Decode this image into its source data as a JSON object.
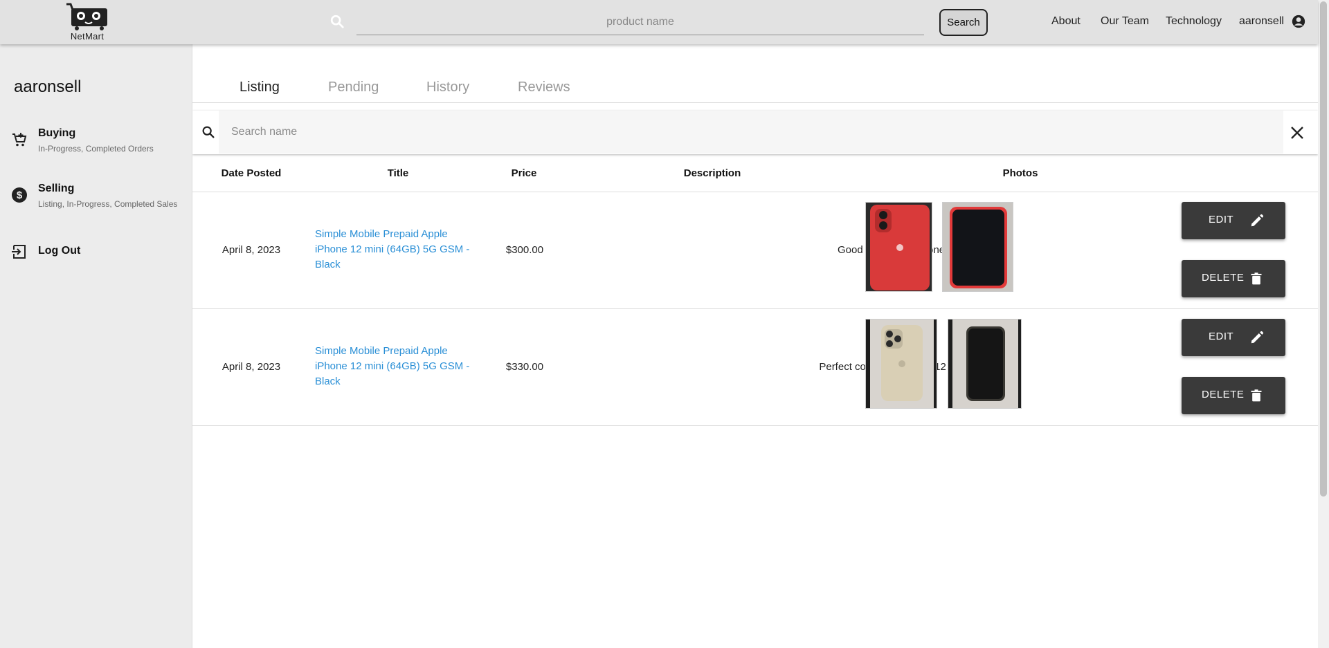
{
  "header": {
    "logo_text": "NetMart",
    "search_placeholder": "product name",
    "search_button": "Search",
    "nav": [
      "About",
      "Our Team",
      "Technology",
      "aaronsell"
    ]
  },
  "sidebar": {
    "username": "aaronsell",
    "items": [
      {
        "label": "Buying",
        "sub": "In-Progress, Completed Orders",
        "icon": "cart-icon"
      },
      {
        "label": "Selling",
        "sub": "Listing, In-Progress, Completed Sales",
        "icon": "dollar-icon"
      },
      {
        "label": "Log Out",
        "sub": "",
        "icon": "logout-icon"
      }
    ]
  },
  "tabs": [
    "Listing",
    "Pending",
    "History",
    "Reviews"
  ],
  "active_tab": "Listing",
  "listing_search": {
    "placeholder": "Search name"
  },
  "table": {
    "headers": [
      "Date Posted",
      "Title",
      "Price",
      "Description",
      "Photos"
    ],
    "rows": [
      {
        "date": "April 8, 2023",
        "title": "Simple Mobile Prepaid Apple iPhone 12 mini (64GB) 5G GSM - Black",
        "price": "$300.00",
        "description": "Good Condition iPhone 12",
        "photos": [
          "red-iphone-back",
          "red-iphone-front"
        ],
        "edit_label": "EDIT",
        "delete_label": "DELETE"
      },
      {
        "date": "April 8, 2023",
        "title": "Simple Mobile Prepaid Apple iPhone 12 mini (64GB) 5G GSM - Black",
        "price": "$330.00",
        "description": "Perfect condition iPhone 12 (Gold)",
        "photos": [
          "gold-iphone-back",
          "gold-iphone-front"
        ],
        "edit_label": "EDIT",
        "delete_label": "DELETE"
      }
    ]
  },
  "colors": {
    "accent_link": "#2a8fd6",
    "button_dark": "#3a3a3a",
    "topbar": "#e2e2e2",
    "sidebar": "#ececec"
  }
}
